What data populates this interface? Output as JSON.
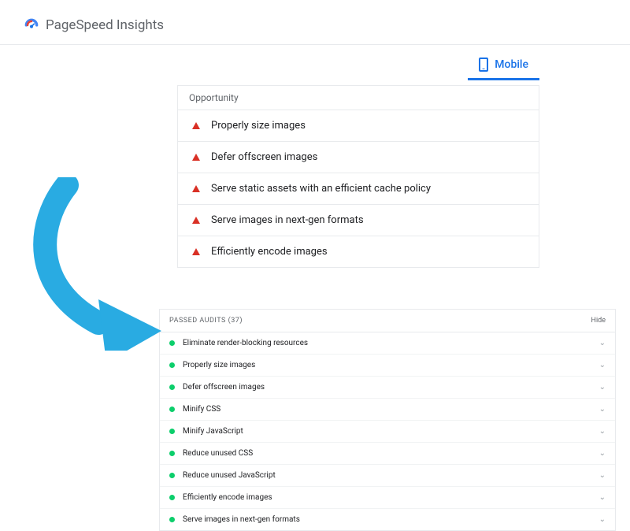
{
  "header": {
    "title": "PageSpeed Insights"
  },
  "tabs": {
    "mobile_label": "Mobile"
  },
  "opportunity": {
    "header": "Opportunity",
    "items": [
      "Properly size images",
      "Defer offscreen images",
      "Serve static assets with an efficient cache policy",
      "Serve images in next-gen formats",
      "Efficiently encode images"
    ]
  },
  "passed": {
    "title_prefix": "PASSED AUDITS",
    "count": "(37)",
    "hide_label": "Hide",
    "items": [
      "Eliminate render-blocking resources",
      "Properly size images",
      "Defer offscreen images",
      "Minify CSS",
      "Minify JavaScript",
      "Reduce unused CSS",
      "Reduce unused JavaScript",
      "Efficiently encode images",
      "Serve images in next-gen formats"
    ]
  }
}
